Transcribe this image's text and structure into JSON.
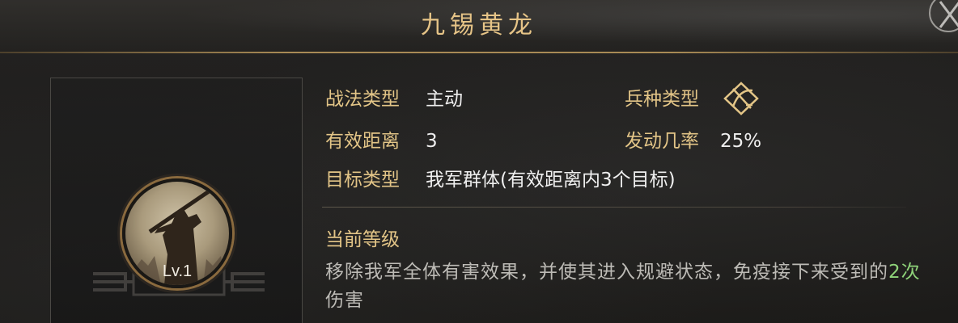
{
  "header": {
    "title": "九锡黄龙"
  },
  "skill": {
    "level": "Lv.1",
    "icon": "spearman-silhouette"
  },
  "info": {
    "tactic_type_label": "战法类型",
    "tactic_type_value": "主动",
    "troop_type_label": "兵种类型",
    "troop_type_icon": "crossed-weapons-icon",
    "range_label": "有效距离",
    "range_value": "3",
    "trigger_rate_label": "发动几率",
    "trigger_rate_value": "25%",
    "target_label": "目标类型",
    "target_value": "我军群体(有效距离内3个目标)"
  },
  "level_section": {
    "heading": "当前等级",
    "desc_part1": "移除我军全体有害效果，并使其进入规避状态，免疫接下来受到的",
    "desc_highlight": "2次",
    "desc_part2": "伤害"
  },
  "colors": {
    "gold": "#e3c587",
    "highlight": "#8fd47a",
    "text": "#efefef"
  }
}
